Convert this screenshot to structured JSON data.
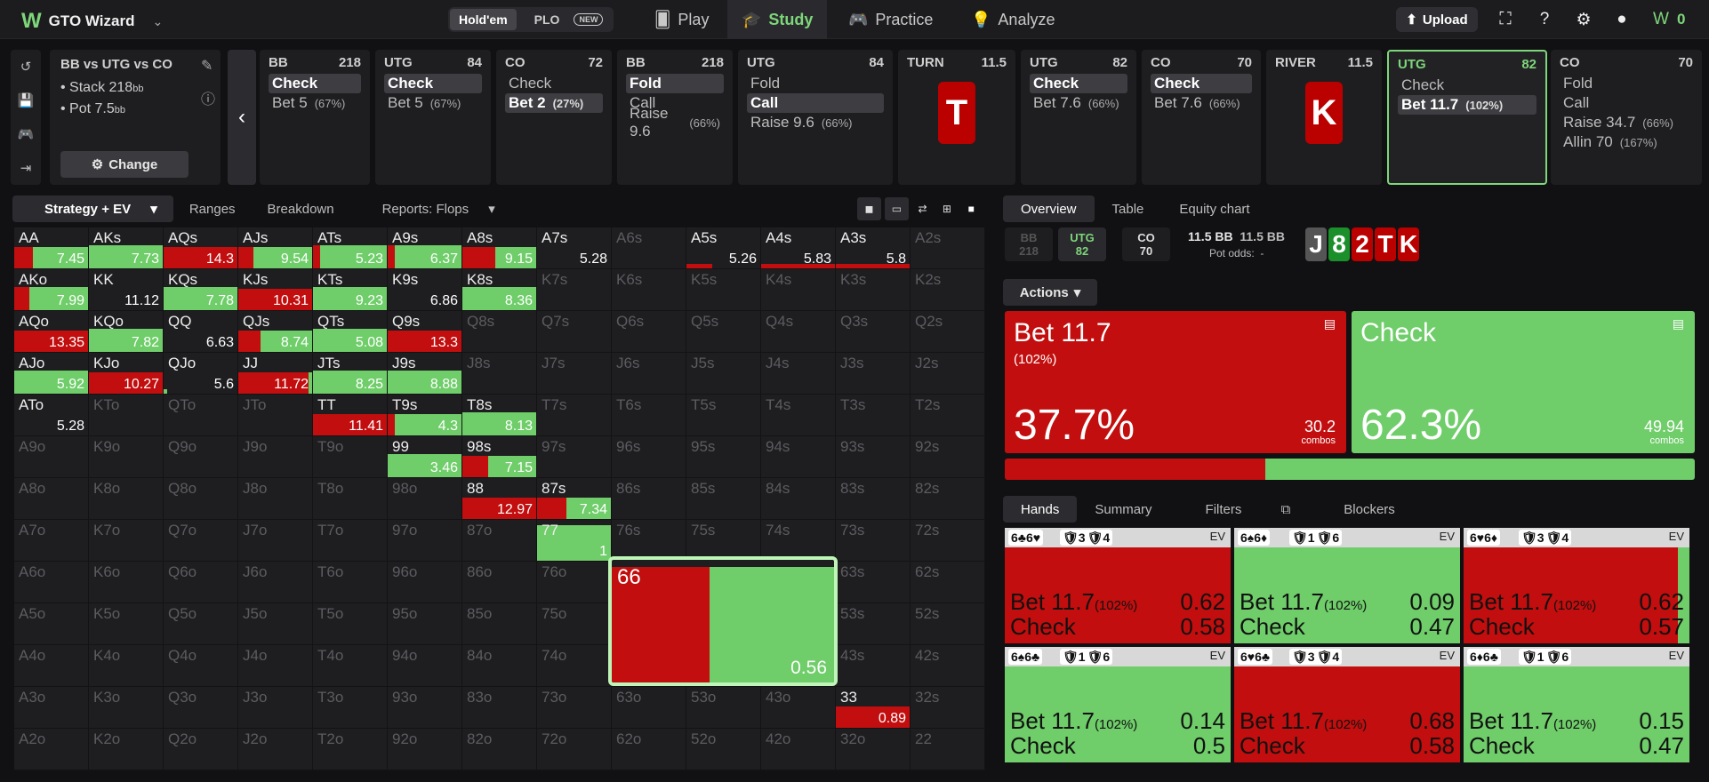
{
  "app": {
    "title": "GTO Wizard",
    "modes": [
      "Hold'em",
      "PLO"
    ],
    "new_badge": "NEW",
    "nav": [
      "Play",
      "Study",
      "Practice",
      "Analyze"
    ],
    "upload": "Upload",
    "count": "0"
  },
  "spot": {
    "title": "BB vs UTG vs CO",
    "stack_label": "Stack 218",
    "stack_unit": "bb",
    "pot_label": "Pot 7.5",
    "pot_unit": "bb",
    "change": "Change"
  },
  "actions": [
    {
      "pos": "BB",
      "stack": "218",
      "lines": [
        {
          "t": "Check",
          "sel": true
        },
        {
          "t": "Bet 5",
          "pct": "(67%)"
        }
      ]
    },
    {
      "pos": "UTG",
      "stack": "84",
      "lines": [
        {
          "t": "Check",
          "sel": true
        },
        {
          "t": "Bet 5",
          "pct": "(67%)"
        }
      ]
    },
    {
      "pos": "CO",
      "stack": "72",
      "lines": [
        {
          "t": "Check"
        },
        {
          "t": "Bet 2",
          "pct": "(27%)",
          "sel": true
        }
      ]
    },
    {
      "pos": "BB",
      "stack": "218",
      "lines": [
        {
          "t": "Fold",
          "sel": true
        },
        {
          "t": "Call"
        },
        {
          "t": "Raise 9.6",
          "pct": "(66%)"
        }
      ]
    },
    {
      "pos": "UTG",
      "stack": "84",
      "lines": [
        {
          "t": "Fold"
        },
        {
          "t": "Call",
          "sel": true
        },
        {
          "t": "Raise 9.6",
          "pct": "(66%)"
        }
      ]
    },
    {
      "pos": "TURN",
      "stack": "11.5",
      "card": "T"
    },
    {
      "pos": "UTG",
      "stack": "82",
      "lines": [
        {
          "t": "Check",
          "sel": true
        },
        {
          "t": "Bet 7.6",
          "pct": "(66%)"
        }
      ]
    },
    {
      "pos": "CO",
      "stack": "70",
      "lines": [
        {
          "t": "Check",
          "sel": true
        },
        {
          "t": "Bet 7.6",
          "pct": "(66%)"
        }
      ]
    },
    {
      "pos": "RIVER",
      "stack": "11.5",
      "card": "K"
    },
    {
      "pos": "UTG",
      "stack": "82",
      "lines": [
        {
          "t": "Check"
        },
        {
          "t": "Bet 11.7",
          "pct": "(102%)",
          "sel": true
        }
      ]
    },
    {
      "pos": "CO",
      "stack": "70",
      "lines": [
        {
          "t": "Fold"
        },
        {
          "t": "Call"
        },
        {
          "t": "Raise 34.7",
          "pct": "(66%)"
        },
        {
          "t": "Allin 70",
          "pct": "(167%)"
        }
      ]
    }
  ],
  "left_tabs": [
    "Strategy + EV",
    "Ranges",
    "Breakdown",
    "Reports: Flops"
  ],
  "grid": {
    "ranks": [
      "A",
      "K",
      "Q",
      "J",
      "T",
      "9",
      "8",
      "7",
      "6",
      "5",
      "4",
      "3",
      "2"
    ],
    "cells": {
      "AA": [
        0.25,
        0.75,
        "7.45"
      ],
      "AKs": [
        0,
        1,
        "7.73"
      ],
      "AQs": [
        1,
        0,
        "14.3"
      ],
      "AJs": [
        0.2,
        0.8,
        "9.54"
      ],
      "ATs": [
        0.1,
        0.9,
        "5.23"
      ],
      "A9s": [
        0.1,
        0.9,
        "6.37"
      ],
      "A8s": [
        0.45,
        0.55,
        "9.15"
      ],
      "A7s": [
        0,
        0,
        "5.28"
      ],
      "A5s": [
        0.35,
        0,
        "5.26"
      ],
      "A4s": [
        1,
        0,
        "5.83"
      ],
      "A3s": [
        1,
        0,
        "5.8"
      ],
      "AKo": [
        0.2,
        0.8,
        "7.99"
      ],
      "KK": [
        0,
        0,
        "11.12"
      ],
      "KQs": [
        0,
        1,
        "7.78"
      ],
      "KJs": [
        1,
        0,
        "10.31"
      ],
      "KTs": [
        0,
        1,
        "9.23"
      ],
      "K9s": [
        0,
        0,
        "6.86"
      ],
      "K8s": [
        0,
        1,
        "8.36"
      ],
      "AQo": [
        1,
        0,
        "13.35"
      ],
      "KQo": [
        0,
        1,
        "7.82"
      ],
      "QQ": [
        0,
        0,
        "6.63"
      ],
      "QJs": [
        0.3,
        0.7,
        "8.74"
      ],
      "QTs": [
        0,
        1,
        "5.08"
      ],
      "Q9s": [
        1,
        0,
        "13.3"
      ],
      "AJo": [
        0,
        1,
        "5.92"
      ],
      "KJo": [
        1,
        0,
        "10.27"
      ],
      "QJo": [
        0,
        0.05,
        "5.6"
      ],
      "JJ": [
        0.95,
        0.05,
        "11.72"
      ],
      "JTs": [
        0,
        1,
        "8.25"
      ],
      "J9s": [
        0,
        1,
        "8.88"
      ],
      "ATo": [
        0,
        0,
        "5.28"
      ],
      "TT": [
        1,
        0,
        "11.41"
      ],
      "T9s": [
        0.1,
        0.9,
        "4.3"
      ],
      "T8s": [
        0,
        1,
        "8.13"
      ],
      "99": [
        0,
        1,
        "3.46"
      ],
      "98s": [
        0.35,
        0.65,
        "7.15"
      ],
      "88": [
        1,
        0,
        "12.97"
      ],
      "87s": [
        0.4,
        0.6,
        "7.34"
      ],
      "77": [
        0,
        1,
        "1"
      ],
      "66": [
        0.44,
        0.56,
        "0.56"
      ],
      "33": [
        1,
        0,
        "0.89"
      ]
    }
  },
  "right_tabs": [
    "Overview",
    "Table",
    "Equity chart"
  ],
  "players": [
    {
      "pos": "BB",
      "stack": "218"
    },
    {
      "pos": "UTG",
      "stack": "82"
    },
    {
      "pos": "CO",
      "stack": "70"
    }
  ],
  "pot": {
    "v1": "11.5 BB",
    "v2": "11.5 BB",
    "odds_label": "Pot odds:",
    "odds": "-"
  },
  "board": [
    "J",
    "8",
    "2",
    "T",
    "K"
  ],
  "actions_label": "Actions",
  "strategy": [
    {
      "label": "Bet 11.7",
      "sub": "(102%)",
      "pct": "37.7%",
      "combos": "30.2",
      "unit": "combos",
      "frac": 0.377
    },
    {
      "label": "Check",
      "sub": "",
      "pct": "62.3%",
      "combos": "49.94",
      "unit": "combos",
      "frac": 0.623
    }
  ],
  "hand_tabs": [
    "Hands",
    "Summary",
    "Filters",
    "Blockers"
  ],
  "hands": [
    {
      "cards": "6♣6♥",
      "b1": "3",
      "b2": "4",
      "bet_ev": "0.62",
      "chk_ev": "0.58",
      "bet": 1
    },
    {
      "cards": "6♠6♦",
      "b1": "1",
      "b2": "6",
      "bet_ev": "0.09",
      "chk_ev": "0.47",
      "bet": 0
    },
    {
      "cards": "6♥6♦",
      "b1": "3",
      "b2": "4",
      "bet_ev": "0.62",
      "chk_ev": "0.57",
      "bet": 0.95
    },
    {
      "cards": "6♠6♣",
      "b1": "1",
      "b2": "6",
      "bet_ev": "0.14",
      "chk_ev": "0.5",
      "bet": 0
    },
    {
      "cards": "6♥6♣",
      "b1": "3",
      "b2": "4",
      "bet_ev": "0.68",
      "chk_ev": "0.58",
      "bet": 1
    },
    {
      "cards": "6♦6♣",
      "b1": "1",
      "b2": "6",
      "bet_ev": "0.15",
      "chk_ev": "0.47",
      "bet": 0
    }
  ],
  "hand_labels": {
    "bet": "Bet 11.7",
    "bet_pct": "(102%)",
    "check": "Check",
    "ev": "EV"
  },
  "colors": {
    "bet": "#c20e0e",
    "check": "#6fcd6a",
    "accent": "#7ed67a"
  }
}
